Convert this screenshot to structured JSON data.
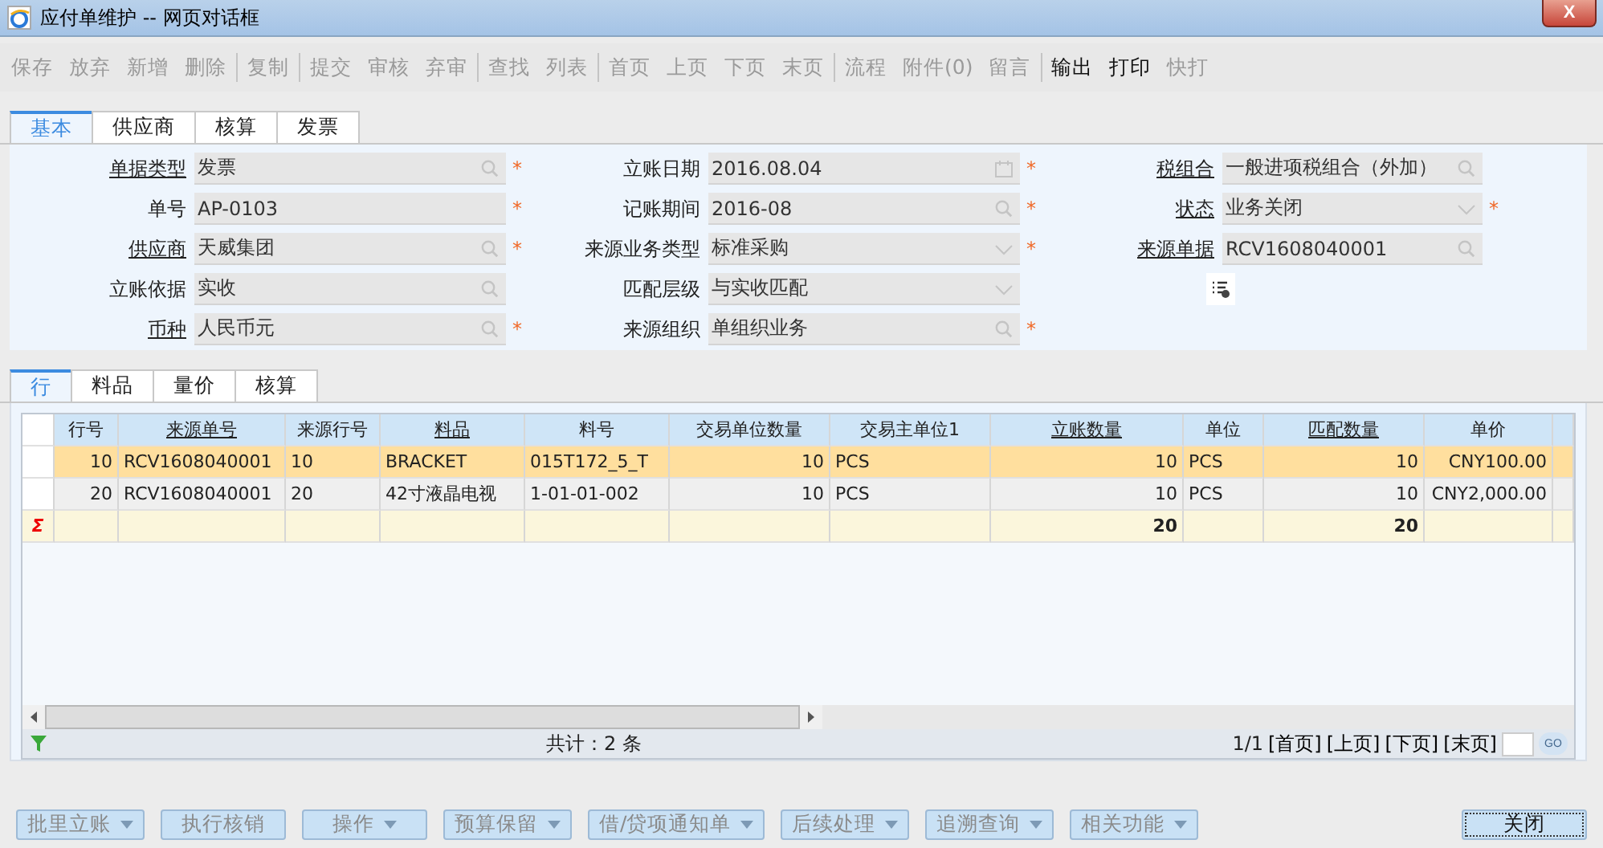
{
  "window": {
    "title": "应付单维护 -- 网页对话框",
    "close": "X"
  },
  "toolbar": [
    [
      {
        "label": "保存",
        "enabled": false
      },
      {
        "label": "放弃",
        "enabled": false
      },
      {
        "label": "新增",
        "enabled": false
      },
      {
        "label": "删除",
        "enabled": false
      }
    ],
    [
      {
        "label": "复制",
        "enabled": false
      }
    ],
    [
      {
        "label": "提交",
        "enabled": false
      },
      {
        "label": "审核",
        "enabled": false
      },
      {
        "label": "弃审",
        "enabled": false
      }
    ],
    [
      {
        "label": "查找",
        "enabled": false
      },
      {
        "label": "列表",
        "enabled": false
      }
    ],
    [
      {
        "label": "首页",
        "enabled": false
      },
      {
        "label": "上页",
        "enabled": false
      },
      {
        "label": "下页",
        "enabled": false
      },
      {
        "label": "末页",
        "enabled": false
      }
    ],
    [
      {
        "label": "流程",
        "enabled": false
      },
      {
        "label": "附件(0)",
        "enabled": false
      },
      {
        "label": "留言",
        "enabled": false
      }
    ],
    [
      {
        "label": "输出",
        "enabled": true
      },
      {
        "label": "打印",
        "enabled": true
      },
      {
        "label": "快打",
        "enabled": false
      }
    ]
  ],
  "header_tabs": [
    {
      "label": "基本",
      "selected": true
    },
    {
      "label": "供应商",
      "selected": false
    },
    {
      "label": "核算",
      "selected": false
    },
    {
      "label": "发票",
      "selected": false
    }
  ],
  "form_columns": [
    [
      {
        "label": "单据类型",
        "link": true,
        "value": "发票",
        "kind": "search",
        "required_mark": "*"
      },
      {
        "label": "单号",
        "link": false,
        "value": "AP-0103",
        "kind": "text",
        "required_mark": "*"
      },
      {
        "label": "供应商",
        "link": true,
        "value": "天威集团",
        "kind": "search",
        "required_mark": "*"
      },
      {
        "label": "立账依据",
        "link": false,
        "value": "实收",
        "kind": "search"
      },
      {
        "label": "币种",
        "link": true,
        "value": "人民币元",
        "kind": "search",
        "required_mark": "*"
      }
    ],
    [
      {
        "label": "立账日期",
        "link": false,
        "value": "2016.08.04",
        "kind": "date",
        "required_mark": "*"
      },
      {
        "label": "记账期间",
        "link": false,
        "value": "2016-08",
        "kind": "search",
        "required_mark": "*"
      },
      {
        "label": "来源业务类型",
        "link": false,
        "value": "标准采购",
        "kind": "dropdown",
        "required_mark": "*"
      },
      {
        "label": "匹配层级",
        "link": false,
        "value": "与实收匹配",
        "kind": "dropdown"
      },
      {
        "label": "来源组织",
        "link": false,
        "value": "单组织业务",
        "kind": "search",
        "required_mark": "*"
      }
    ],
    [
      {
        "label": "税组合",
        "link": true,
        "value": "一般进项税组合（外加）",
        "kind": "search"
      },
      {
        "label": "状态",
        "link": true,
        "value": "业务关闭",
        "kind": "dropdown",
        "required_mark": "*"
      },
      {
        "label": "来源单据",
        "link": true,
        "value": "RCV1608040001",
        "kind": "search"
      },
      {
        "kind": "tool"
      }
    ]
  ],
  "line_tabs": [
    {
      "label": "行",
      "selected": true
    },
    {
      "label": "料品",
      "selected": false
    },
    {
      "label": "量价",
      "selected": false
    },
    {
      "label": "核算",
      "selected": false
    }
  ],
  "table": {
    "columns": [
      {
        "label": "行号",
        "link": false
      },
      {
        "label": "来源单号",
        "link": true
      },
      {
        "label": "来源行号",
        "link": false
      },
      {
        "label": "料品",
        "link": true
      },
      {
        "label": "料号",
        "link": false
      },
      {
        "label": "交易单位数量",
        "link": false
      },
      {
        "label": "交易主单位1",
        "link": false
      },
      {
        "label": "立账数量",
        "link": true
      },
      {
        "label": "单位",
        "link": false
      },
      {
        "label": "匹配数量",
        "link": true
      },
      {
        "label": "单价",
        "link": false
      }
    ],
    "rows": [
      {
        "selected": true,
        "cells": [
          "10",
          "RCV1608040001",
          "10",
          "BRACKET",
          "015T172_5_T",
          "10",
          "PCS",
          "10",
          "PCS",
          "10",
          "CNY100.00"
        ]
      },
      {
        "selected": false,
        "cells": [
          "20",
          "RCV1608040001",
          "20",
          "42寸液晶电视",
          "1-01-01-002",
          "10",
          "PCS",
          "10",
          "PCS",
          "10",
          "CNY2,000.00"
        ]
      }
    ],
    "sum_row": {
      "mark": "Σ",
      "cells": [
        "",
        "",
        "",
        "",
        "",
        "",
        "",
        "20",
        "",
        "20",
        ""
      ]
    }
  },
  "footer": {
    "total": "共计：2 条",
    "page": "1/1",
    "pager": [
      "[首页]",
      "[上页]",
      "[下页]",
      "[末页]"
    ],
    "go": "GO"
  },
  "bottom_buttons": [
    {
      "label": "批里立账",
      "kind": "menu"
    },
    {
      "label": "执行核销",
      "kind": "plain"
    },
    {
      "label": "操作",
      "kind": "menu"
    },
    {
      "label": "预算保留",
      "kind": "menu"
    },
    {
      "label": "借/贷项通知单",
      "kind": "menu"
    },
    {
      "label": "后续处理",
      "kind": "menu"
    },
    {
      "label": "追溯查询",
      "kind": "menu"
    },
    {
      "label": "相关功能",
      "kind": "menu"
    }
  ],
  "close_button": "关闭"
}
